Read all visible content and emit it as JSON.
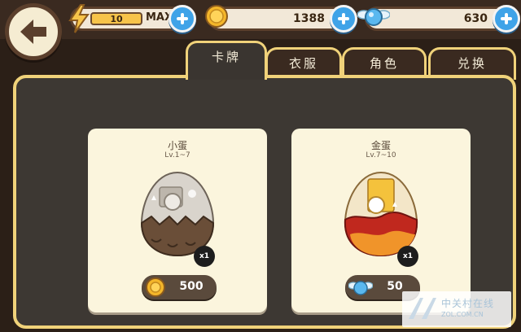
{
  "topbar": {
    "energy_value": "10",
    "energy_max_label": "MAX",
    "coins_value": "1388",
    "gems_value": "630",
    "icons": {
      "back": "back-arrow-icon",
      "energy": "lightning-icon",
      "coin": "coin-icon",
      "gem": "winged-gem-icon",
      "add": "plus-icon"
    }
  },
  "tabs": [
    {
      "label": "卡牌",
      "active": true
    },
    {
      "label": "衣服",
      "active": false
    },
    {
      "label": "角色",
      "active": false
    },
    {
      "label": "兑换",
      "active": false
    }
  ],
  "cards": [
    {
      "title": "小蛋",
      "level": "Lv.1~7",
      "quantity": "x1",
      "price": "500",
      "currency": "coin-icon"
    },
    {
      "title": "金蛋",
      "level": "Lv.7~10",
      "quantity": "x1",
      "price": "50",
      "currency": "winged-gem-icon"
    }
  ],
  "colors": {
    "accent_gold": "#f0d27a",
    "plus_blue": "#3fa3e8",
    "panel": "#3d3833",
    "card": "#fbf5dd"
  },
  "watermark": {
    "line1": "中关村在线",
    "line2": "ZOL.COM.CN"
  }
}
